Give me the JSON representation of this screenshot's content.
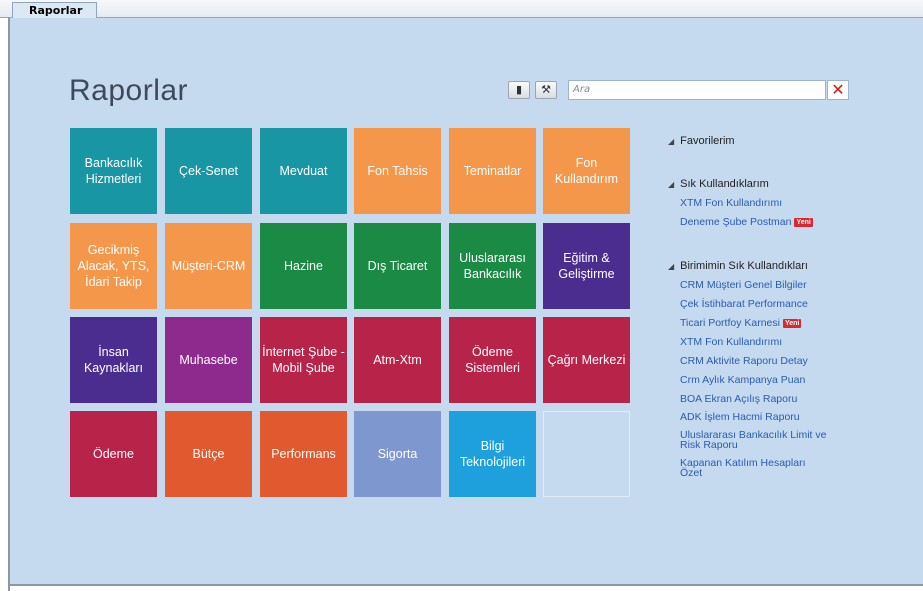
{
  "tab": {
    "label": "Raporlar"
  },
  "page": {
    "title": "Raporlar"
  },
  "toolbar": {
    "search_placeholder": "Ara",
    "clear_label": "✕"
  },
  "tiles": [
    {
      "label": "Bankacılık Hizmetleri",
      "color": "#1896a3"
    },
    {
      "label": "Çek-Senet",
      "color": "#1896a3"
    },
    {
      "label": "Mevduat",
      "color": "#1896a3"
    },
    {
      "label": "Fon Tahsis",
      "color": "#f5974a"
    },
    {
      "label": "Teminatlar",
      "color": "#f5974a"
    },
    {
      "label": "Fon Kullandırım",
      "color": "#f5974a"
    },
    {
      "label": "Gecikmiş Alacak, YTS, İdari Takip",
      "color": "#f5974a"
    },
    {
      "label": "Müşteri-CRM",
      "color": "#f5974a"
    },
    {
      "label": "Hazine",
      "color": "#1a8a44"
    },
    {
      "label": "Dış Ticaret",
      "color": "#1a8a44"
    },
    {
      "label": "Uluslararası Bankacılık",
      "color": "#1a8a44"
    },
    {
      "label": "Eğitim & Geliştirme",
      "color": "#4b2d8f"
    },
    {
      "label": "İnsan Kaynakları",
      "color": "#4b2d8f"
    },
    {
      "label": "Muhasebe",
      "color": "#8e2a8e"
    },
    {
      "label": "İnternet Şube - Mobil Şube",
      "color": "#b8234a"
    },
    {
      "label": "Atm-Xtm",
      "color": "#b8234a"
    },
    {
      "label": "Ödeme Sistemleri",
      "color": "#b8234a"
    },
    {
      "label": "Çağrı Merkezi",
      "color": "#b8234a"
    },
    {
      "label": "Ödeme",
      "color": "#b8234a"
    },
    {
      "label": "Bütçe",
      "color": "#e0592f"
    },
    {
      "label": "Performans",
      "color": "#e0592f"
    },
    {
      "label": "Sigorta",
      "color": "#7f97cf"
    },
    {
      "label": "Bilgi Teknolojileri",
      "color": "#1ea0dc"
    }
  ],
  "sidebar": {
    "favorites": {
      "title": "Favorilerim"
    },
    "frequent": {
      "title": "Sık Kullandıklarım",
      "items": [
        {
          "label": "XTM Fon Kullandırımı",
          "badge": ""
        },
        {
          "label": "Deneme Şube Postman",
          "badge": "Yeni"
        }
      ]
    },
    "unit_frequent": {
      "title": "Birimimin Sık Kullandıkları",
      "items": [
        {
          "label": "CRM Müşteri Genel Bilgiler",
          "badge": ""
        },
        {
          "label": "Çek İstihbarat Performance",
          "badge": ""
        },
        {
          "label": "Ticari Portfoy Karnesi",
          "badge": "Yeni"
        },
        {
          "label": "XTM Fon Kullandırımı",
          "badge": ""
        },
        {
          "label": "CRM Aktivite Raporu Detay",
          "badge": ""
        },
        {
          "label": "Crm Aylık Kampanya Puan",
          "badge": ""
        },
        {
          "label": "BOA Ekran Açılış Raporu",
          "badge": ""
        },
        {
          "label": "ADK İşlem Hacmi Raporu",
          "badge": ""
        },
        {
          "label": "Uluslararası Bankacılık Limit ve Risk Raporu",
          "badge": ""
        },
        {
          "label": "Kapanan Katılım Hesapları Özet",
          "badge": ""
        }
      ]
    }
  }
}
